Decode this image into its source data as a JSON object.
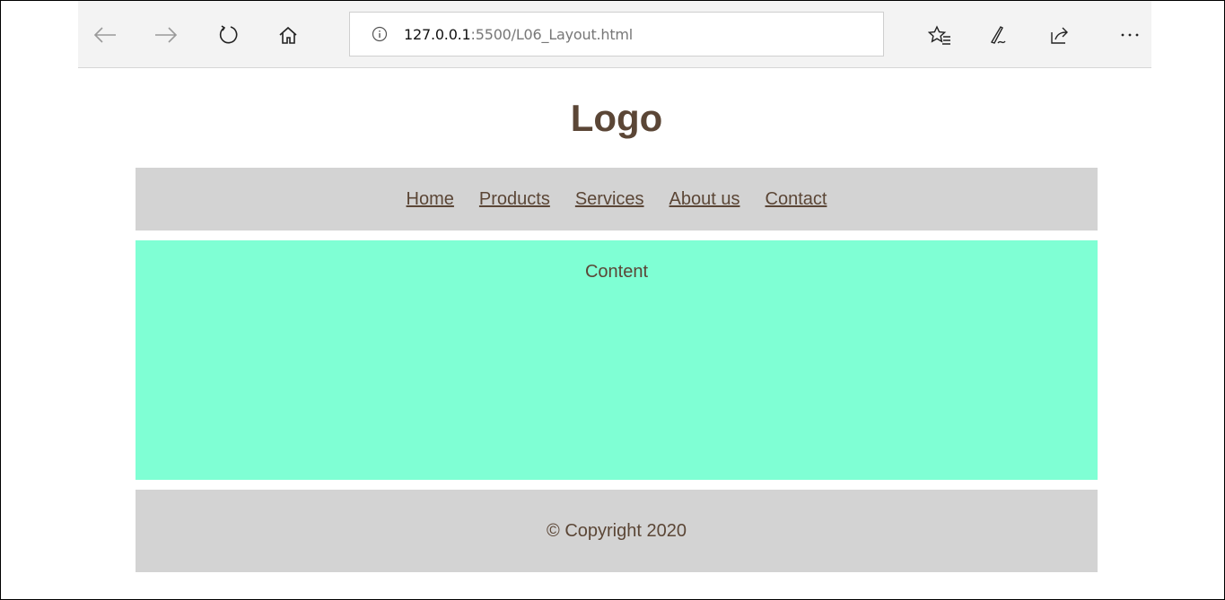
{
  "browser": {
    "url_host": "127.0.0.1",
    "url_rest": ":5500/L06_Layout.html",
    "icons": [
      "back-arrow-icon",
      "forward-arrow-icon",
      "refresh-icon",
      "home-icon",
      "info-icon",
      "favorites-icon",
      "pen-icon",
      "share-icon",
      "more-icon"
    ]
  },
  "page": {
    "logo": "Logo",
    "nav": [
      {
        "label": "Home"
      },
      {
        "label": "Products"
      },
      {
        "label": "Services"
      },
      {
        "label": "About us"
      },
      {
        "label": "Contact"
      }
    ],
    "content": "Content",
    "footer": "© Copyright 2020"
  },
  "colors": {
    "text": "#5b4636",
    "nav_bg": "#d3d3d3",
    "content_bg": "#7fffd4",
    "footer_bg": "#d3d3d3"
  }
}
